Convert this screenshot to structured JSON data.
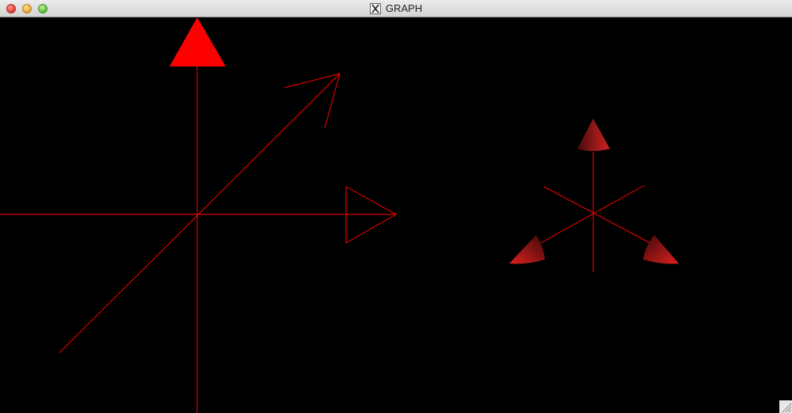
{
  "window": {
    "title": "GRAPH",
    "title_icon": "x11-icon",
    "buttons": [
      "close-button",
      "minimize-button",
      "zoom-button"
    ]
  },
  "scene": {
    "background_color": "#000000",
    "line_color": "#ff0000",
    "left_view": {
      "description_icon": "axes-3d-wireframe",
      "arrowheads": [
        "filled-triangle-up",
        "open-arrow-diagonal",
        "outline-triangle-right"
      ]
    },
    "right_view": {
      "description_icon": "axes-3d-shaded",
      "cones": [
        "cone-up",
        "cone-left",
        "cone-right"
      ]
    }
  }
}
